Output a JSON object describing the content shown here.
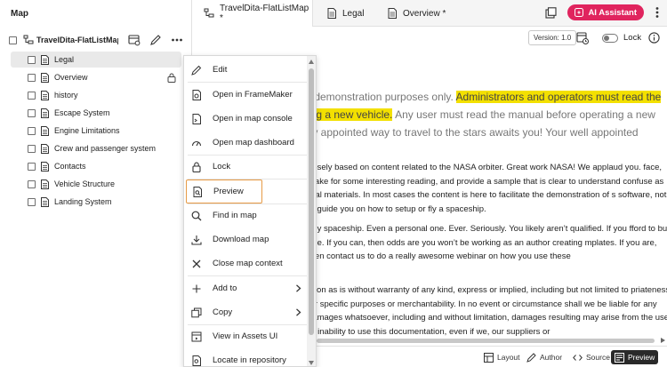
{
  "panel": {
    "title": "Map"
  },
  "map_root": {
    "label": "TravelDita-FlatListMap"
  },
  "tree_items": [
    {
      "label": "Legal",
      "selected": true,
      "locked": false
    },
    {
      "label": "Overview",
      "selected": false,
      "locked": true
    },
    {
      "label": "history",
      "selected": false,
      "locked": false
    },
    {
      "label": "Escape System",
      "selected": false,
      "locked": false
    },
    {
      "label": "Engine Limitations",
      "selected": false,
      "locked": false
    },
    {
      "label": "Crew and passenger system",
      "selected": false,
      "locked": false
    },
    {
      "label": "Contacts",
      "selected": false,
      "locked": false
    },
    {
      "label": "Vehicle Structure",
      "selected": false,
      "locked": false
    },
    {
      "label": "Landing System",
      "selected": false,
      "locked": false
    }
  ],
  "tabs": [
    {
      "label": "TravelDita-FlatListMap *",
      "icon": "map-icon"
    },
    {
      "label": "Legal",
      "icon": "document-icon"
    },
    {
      "label": "Overview *",
      "icon": "document-icon"
    }
  ],
  "header": {
    "ai_assistant_label": "AI Assistant"
  },
  "editor_toolbar": {
    "version_label": "Version: 1.0",
    "lock_label": "Lock"
  },
  "content": {
    "lead_plain_1": "r demonstration purposes only. ",
    "lead_highlight_1": "Administrators and operators must read the",
    "lead_highlight_2": "ing a new vehicle.",
    "lead_plain_2": " Any user must read the manual before operating a new",
    "lead_plain_3": "lly appointed way to travel to the stars awaits you! Your well appointed",
    "paragraph_1": "posely based on content related to the NASA orbiter. Great work NASA! We applaud you. face, make for some interesting reading, and provide a sample that is clear to understand confuse as real materials. In most cases the content is here to facilitate the demonstration of s software, not to guide you on how to setup or fly a spaceship.",
    "paragraph_2": "any spaceship. Even a personal one. Ever. Seriously. You likely aren’t qualified. If you fford to buy one. If you can, then odds are you won’t be working as an author creating mplates. If you are, then contact us to do a really awesome webinar on how you use these",
    "paragraph_3": "ation as is without warranty of any kind, express or implied, including but not limited to priateness for specific purposes or merchantability. In no event or circumstance shall we be liable for any damages whatsoever, including and without limitation, damages resulting may arise from the use or inability to use this documentation, even if we, our suppliers or"
  },
  "context_menu": {
    "items": [
      {
        "label": "Edit",
        "icon": "pencil-icon"
      },
      {
        "label": "Open in FrameMaker",
        "icon": "framemaker-document-icon"
      },
      {
        "label": "Open in map console",
        "icon": "map-console-icon"
      },
      {
        "label": "Open map dashboard",
        "icon": "dashboard-icon"
      },
      {
        "label": "Lock",
        "icon": "lock-icon"
      },
      {
        "label": "Preview",
        "icon": "preview-icon"
      },
      {
        "label": "Find in map",
        "icon": "search-icon"
      },
      {
        "label": "Download map",
        "icon": "download-icon"
      },
      {
        "label": "Close map context",
        "icon": "close-icon"
      },
      {
        "label": "Add to",
        "icon": "plus-icon",
        "submenu": true
      },
      {
        "label": "Copy",
        "icon": "copy-icon",
        "submenu": true
      },
      {
        "label": "View in Assets UI",
        "icon": "assets-ui-icon"
      },
      {
        "label": "Locate in repository",
        "icon": "locate-icon"
      }
    ]
  },
  "view_modes": [
    {
      "label": "Layout",
      "icon": "layout-icon"
    },
    {
      "label": "Author",
      "icon": "author-icon"
    },
    {
      "label": "Source",
      "icon": "source-code-icon"
    },
    {
      "label": "Preview",
      "icon": "preview-icon",
      "active": true
    }
  ],
  "colors": {
    "accent": "#e0245e",
    "highlight": "#f3e000",
    "focus_ring": "#e79a45"
  }
}
